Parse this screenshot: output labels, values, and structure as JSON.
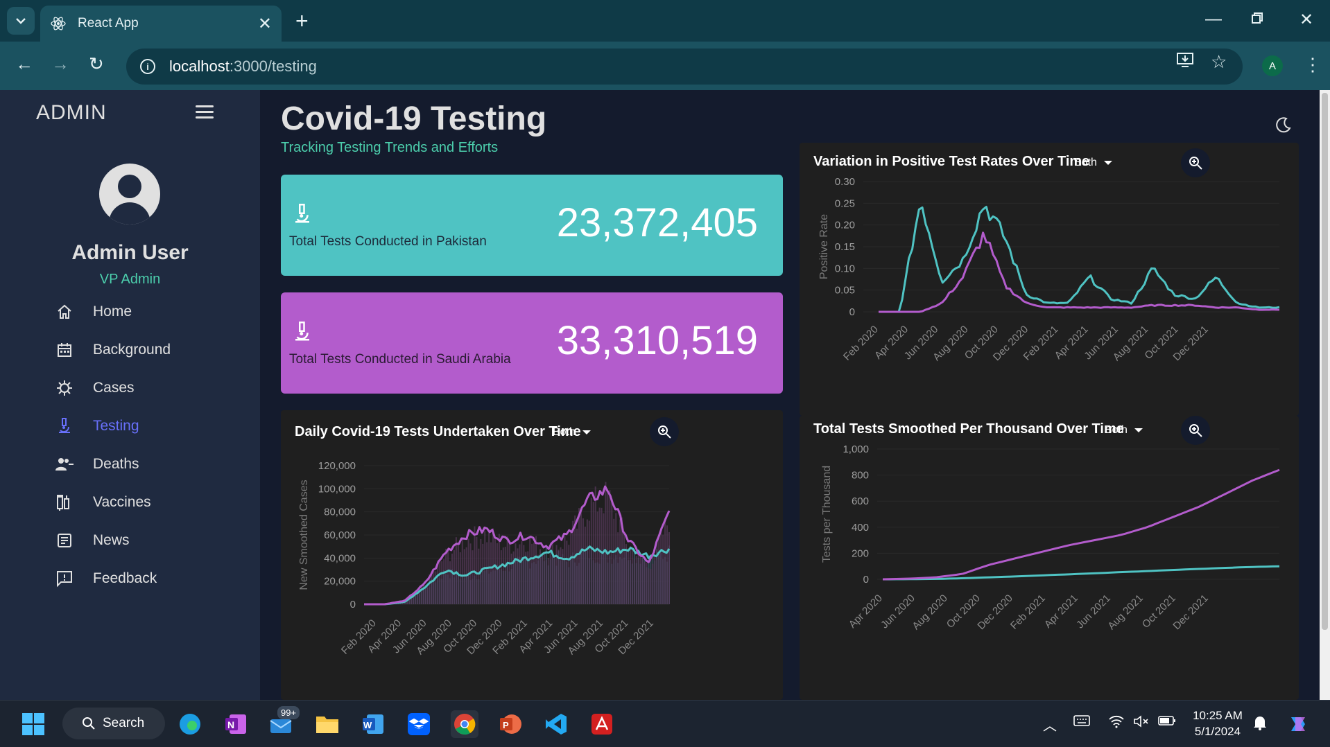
{
  "browser": {
    "tab_title": "React App",
    "url_host": "localhost",
    "url_path": ":3000/testing",
    "profile_initial": "A"
  },
  "sidebar": {
    "brand": "ADMIN",
    "user_name": "Admin User",
    "user_role": "VP Admin",
    "items": [
      {
        "label": "Home",
        "icon": "home-icon"
      },
      {
        "label": "Background",
        "icon": "calendar-icon"
      },
      {
        "label": "Cases",
        "icon": "virus-icon"
      },
      {
        "label": "Testing",
        "icon": "microscope-icon",
        "active": true
      },
      {
        "label": "Deaths",
        "icon": "people-remove-icon"
      },
      {
        "label": "Vaccines",
        "icon": "vaccine-icon"
      },
      {
        "label": "News",
        "icon": "article-icon"
      },
      {
        "label": "Feedback",
        "icon": "feedback-icon"
      }
    ]
  },
  "header": {
    "title": "Covid-19 Testing",
    "subtitle": "Tracking Testing Trends and Efforts"
  },
  "stats": [
    {
      "label": "Total Tests Conducted in Pakistan",
      "value": "23,372,405",
      "color": "#4fc3c3"
    },
    {
      "label": "Total Tests Conducted in Saudi Arabia",
      "value": "33,310,519",
      "color": "#b35ccc"
    }
  ],
  "colors": {
    "pakistan": "#4fc3c3",
    "saudi_arabia": "#b35ccc",
    "accent": "#4cceac",
    "active_menu": "#6870fa"
  },
  "chart_data": [
    {
      "type": "bar",
      "title": "Daily Covid-19 Tests Undertaken Over Time",
      "filter": "Both",
      "xlabel": "",
      "ylabel": "New Smoothed Cases",
      "ylim": [
        0,
        120000
      ],
      "yticks": [
        "120,000",
        "100,000",
        "80,000",
        "60,000",
        "40,000",
        "20,000",
        "0"
      ],
      "xticks": [
        "Feb 2020",
        "Apr 2020",
        "Jun 2020",
        "Aug 2020",
        "Oct 2020",
        "Dec 2020",
        "Feb 2021",
        "Apr 2021",
        "Jun 2021",
        "Aug 2021",
        "Oct 2021",
        "Dec 2021"
      ],
      "series": [
        {
          "values": [
            0,
            0,
            2000,
            15000,
            30000,
            25000,
            30000,
            35000,
            40000,
            45000,
            40000,
            48000,
            45000,
            48000,
            42000,
            48000
          ]
        },
        {
          "values": [
            0,
            0,
            3000,
            18000,
            45000,
            60000,
            65000,
            55000,
            60000,
            50000,
            60000,
            90000,
            100000,
            55000,
            35000,
            80000
          ]
        }
      ]
    },
    {
      "type": "line",
      "title": "Variation in Positive Test Rates Over Time",
      "filter": "Both",
      "xlabel": "",
      "ylabel": "Positive Rate",
      "ylim": [
        0,
        0.3
      ],
      "yticks": [
        "0.30",
        "0.25",
        "0.20",
        "0.15",
        "0.10",
        "0.05",
        "0"
      ],
      "xticks": [
        "Feb 2020",
        "Apr 2020",
        "Jun 2020",
        "Aug 2020",
        "Oct 2020",
        "Dec 2020",
        "Feb 2021",
        "Apr 2021",
        "Jun 2021",
        "Aug 2021",
        "Oct 2021",
        "Dec 2021"
      ],
      "series": [
        {
          "values": [
            0,
            0,
            0.26,
            0.07,
            0.12,
            0.25,
            0.17,
            0.04,
            0.02,
            0.02,
            0.08,
            0.03,
            0.02,
            0.1,
            0.04,
            0.03,
            0.08,
            0.02,
            0.01,
            0.01
          ]
        },
        {
          "values": [
            0,
            0,
            0.0,
            0.02,
            0.08,
            0.18,
            0.06,
            0.02,
            0.01,
            0.01,
            0.01,
            0.01,
            0.01,
            0.015,
            0.015,
            0.015,
            0.01,
            0.01,
            0.005,
            0.005
          ]
        }
      ]
    },
    {
      "type": "line",
      "title": "Total Tests Smoothed Per Thousand Over Time",
      "filter": "Both",
      "xlabel": "",
      "ylabel": "Tests per Thousand",
      "ylim": [
        0,
        1000
      ],
      "yticks": [
        "1,000",
        "800",
        "600",
        "400",
        "200",
        "0"
      ],
      "xticks": [
        "Apr 2020",
        "Jun 2020",
        "Aug 2020",
        "Oct 2020",
        "Dec 2020",
        "Feb 2021",
        "Apr 2021",
        "Jun 2021",
        "Aug 2021",
        "Oct 2021",
        "Dec 2021"
      ],
      "series": [
        {
          "values": [
            0,
            1,
            3,
            8,
            15,
            22,
            30,
            38,
            46,
            55,
            63,
            72,
            80,
            88,
            95,
            100
          ]
        },
        {
          "values": [
            0,
            5,
            15,
            40,
            110,
            160,
            210,
            260,
            300,
            340,
            400,
            480,
            560,
            660,
            760,
            840
          ]
        }
      ]
    }
  ],
  "taskbar": {
    "search_label": "Search",
    "mail_badge": "99+",
    "time": "10:25 AM",
    "date": "5/1/2024"
  }
}
